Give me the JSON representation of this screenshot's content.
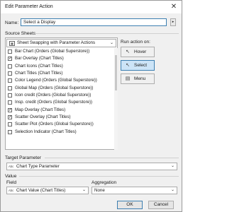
{
  "window": {
    "title": "Edit Parameter Action",
    "close_label": "✕"
  },
  "name": {
    "label": "Name:",
    "value": "Select a Display",
    "arrow_label": "▸"
  },
  "source_sheets": {
    "section_label": "Source Sheets",
    "selector_value": "Sheet Swapping with Parameter Actions",
    "sheets": [
      {
        "label": "Bar Chart (Orders (Global Superstore))",
        "checked": false,
        "mark": ""
      },
      {
        "label": "Bar Overlay (Chart Titles)",
        "checked": true,
        "mark": "✓"
      },
      {
        "label": "Chart Icons (Chart Titles)",
        "checked": false,
        "mark": ""
      },
      {
        "label": "Chart Titles (Chart Titles)",
        "checked": false,
        "mark": ""
      },
      {
        "label": "Color Legend (Orders (Global Superstore))",
        "checked": false,
        "mark": ""
      },
      {
        "label": "Global Map (Orders (Global Superstore))",
        "checked": false,
        "mark": ""
      },
      {
        "label": "Icon credit (Orders (Global Superstore))",
        "checked": false,
        "mark": ""
      },
      {
        "label": "Insp. credit (Orders (Global Superstore))",
        "checked": false,
        "mark": ""
      },
      {
        "label": "Map Overlay (Chart Titles)",
        "checked": true,
        "mark": "✓"
      },
      {
        "label": "Scatter Overlay (Chart Titles)",
        "checked": true,
        "mark": "✓"
      },
      {
        "label": "Scatter Plot (Orders (Global Superstore))",
        "checked": false,
        "mark": ""
      },
      {
        "label": "Selection Indicator (Chart Titles)",
        "checked": false,
        "mark": ""
      }
    ]
  },
  "run_action": {
    "label": "Run action on:",
    "options": [
      {
        "label": "Hover",
        "icon": "pointer-icon",
        "glyph": "↖",
        "selected": false
      },
      {
        "label": "Select",
        "icon": "select-icon",
        "glyph": "↖",
        "selected": true
      },
      {
        "label": "Menu",
        "icon": "menu-icon",
        "glyph": "▤",
        "selected": false
      }
    ]
  },
  "target_parameter": {
    "section_label": "Target Parameter",
    "type_tag": "Abc",
    "value": "Chart Type Parameter"
  },
  "value": {
    "section_label": "Value",
    "field_label": "Field",
    "field_type_tag": "Abc",
    "field_value": "Chart Value (Chart Titles)",
    "aggregation_label": "Aggregation",
    "aggregation_value": "None"
  },
  "buttons": {
    "ok": "OK",
    "cancel": "Cancel"
  },
  "colors": {
    "accent": "#3c7fb1",
    "selected_bg": "#cce4f7",
    "dialog_bg": "#f0f0f0"
  }
}
